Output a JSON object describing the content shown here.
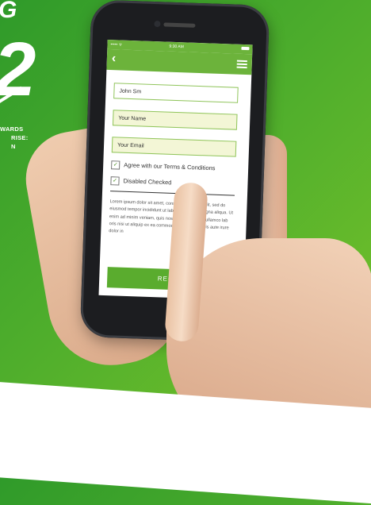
{
  "promo": {
    "top_text": "G",
    "big_text": "2",
    "lines": [
      "WARDS",
      "RISE:",
      "N"
    ]
  },
  "status_bar": {
    "carrier": "••••• ᯤ",
    "time": "9:30 AM"
  },
  "form": {
    "name_value": "John Sm",
    "your_name_placeholder": "Your Name",
    "email_placeholder": "Your Email",
    "agree_label": "Agree with our Terms & Conditions",
    "disabled_label": "Disabled Checked",
    "lorem": "Lorem ipsum dolor sit amet, consectetur ascing elit, sed do eiusmod tempor incididunt ut labore et dolore magna aliqua. Ut enim ad minim veniam, quis nostrud exercitation ullamco lab oris nisi ut aliquip ex ea commodo consequat. Duis aute irure dolor in",
    "register_label": "REGIS"
  },
  "colors": {
    "brand_green": "#6cb33b",
    "button_green": "#5aac2e"
  }
}
